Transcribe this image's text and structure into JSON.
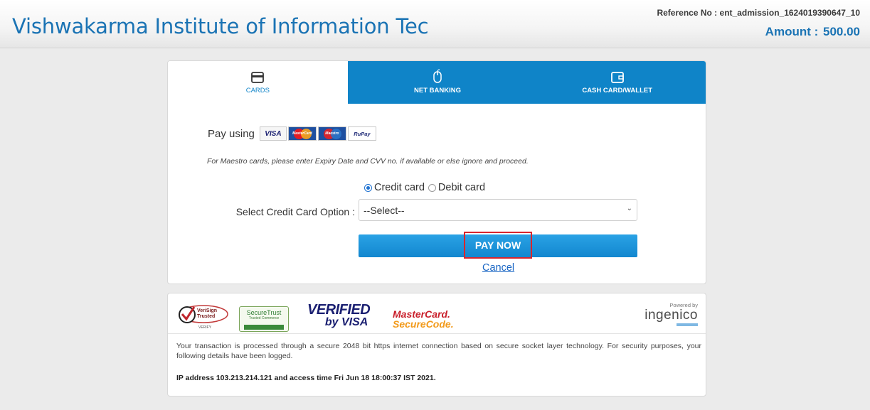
{
  "header": {
    "institute_name": "Vishwakarma Institute of Information Tec",
    "reference_label": "Reference No :",
    "reference_value": "ent_admission_1624019390647_10",
    "amount_label": "Amount :",
    "amount_value": "500.00"
  },
  "tabs": [
    {
      "label": "CARDS",
      "icon": "card-icon",
      "active": true
    },
    {
      "label": "NET BANKING",
      "icon": "mouse-icon",
      "active": false
    },
    {
      "label": "CASH CARD/WALLET",
      "icon": "wallet-icon",
      "active": false
    }
  ],
  "cards_form": {
    "pay_using_label": "Pay using",
    "card_logos": {
      "visa": "VISA",
      "mastercard": "MasterCard",
      "maestro": "Maestro",
      "rupay": "RuPay"
    },
    "maestro_note": "For Maestro cards, please enter Expiry Date and CVV no. if available or else ignore and proceed.",
    "card_type_options": [
      {
        "label": "Credit card",
        "checked": true
      },
      {
        "label": "Debit card",
        "checked": false
      }
    ],
    "select_label": "Select Credit Card Option :",
    "select_value": "--Select--",
    "pay_button": "PAY NOW",
    "cancel_link": "Cancel"
  },
  "footer": {
    "seals": {
      "verisign": "VeriSign Trusted",
      "verisign_sub": "VERIFY",
      "securetrust": "SecureTrust",
      "securetrust_sub": "Trusted Commerce",
      "verified_line1": "VERIFIED",
      "verified_line2": "by VISA",
      "mastercard_line1": "MasterCard.",
      "mastercard_line2": "SecureCode.",
      "powered_by": "Powered by",
      "ingenico": "ingenico"
    },
    "security_text": "Your transaction is processed through a secure 2048 bit https internet connection based on secure socket layer technology. For security purposes, your following details have been logged.",
    "ip_text": "IP address 103.213.214.121 and access time Fri Jun 18 18:00:37 IST 2021."
  },
  "colors": {
    "brand_blue": "#1a73b4",
    "tab_blue": "#0f84c8",
    "pay_button_highlight": "#d8262d",
    "page_background": "#ebebeb"
  }
}
